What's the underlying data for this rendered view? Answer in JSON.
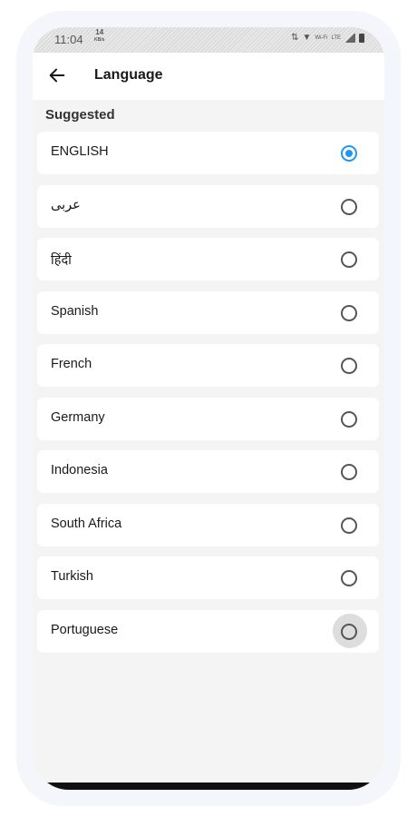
{
  "status_bar": {
    "time": "11:04",
    "speed_value": "14",
    "speed_unit": "KB/s",
    "wifi_label": "Wi-Fi",
    "network": "LTE"
  },
  "app_bar": {
    "back_icon": "arrow-left-icon",
    "title": "Language"
  },
  "section_title": "Suggested",
  "languages": [
    {
      "label": "ENGLISH",
      "selected": true
    },
    {
      "label": "عربى",
      "selected": false
    },
    {
      "label": "हिंदी",
      "selected": false
    },
    {
      "label": "Spanish",
      "selected": false
    },
    {
      "label": "French",
      "selected": false
    },
    {
      "label": "Germany",
      "selected": false
    },
    {
      "label": "Indonesia",
      "selected": false
    },
    {
      "label": "South Africa",
      "selected": false
    },
    {
      "label": "Turkish",
      "selected": false
    },
    {
      "label": "Portuguese",
      "selected": false,
      "pressed": true
    }
  ],
  "colors": {
    "accent": "#2196f3",
    "background": "#f4f4f4",
    "card": "#ffffff"
  }
}
